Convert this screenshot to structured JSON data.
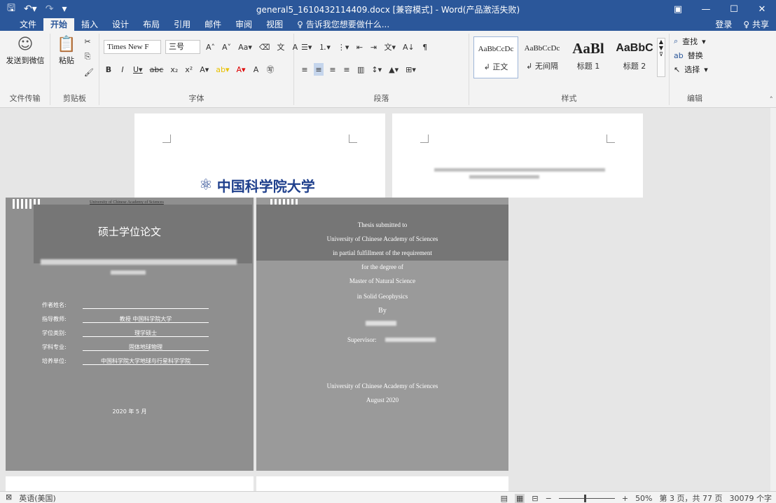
{
  "titlebar": {
    "doc_title": "general5_1610432114409.docx [兼容模式] - Word(产品激活失败)",
    "qa_icons": [
      "save-icon",
      "undo-icon",
      "redo-icon",
      "customize-icon"
    ],
    "tabs": [
      "文件",
      "开始",
      "插入",
      "设计",
      "布局",
      "引用",
      "邮件",
      "审阅",
      "视图"
    ],
    "active_tab": "开始",
    "search": "♀ 告诉我您想要做什么...",
    "signin": "登录",
    "share": "♀ 共享"
  },
  "ribbon": {
    "send_wechat": "发送到微信",
    "paste": "粘贴",
    "font_name": "Times New F",
    "font_size": "三号",
    "styles": [
      {
        "sample": "AaBbCcDc",
        "name": "正文"
      },
      {
        "sample": "AaBbCcDc",
        "name": "无间隔"
      },
      {
        "sample": "AaBl",
        "name": "标题 1"
      },
      {
        "sample": "AaBbC",
        "name": "标题 2"
      }
    ],
    "find": "查找",
    "replace": "替换",
    "select": "选择",
    "groups": [
      "文件传输",
      "剪贴板",
      "字体",
      "段落",
      "样式",
      "编辑"
    ]
  },
  "document": {
    "logo_text": "中国科学院大学",
    "logo_sub": "University of Chinese Academy of Sciences",
    "cn_title": "硕士学位论文",
    "info_labels": [
      "作者姓名:",
      "指导教师:",
      "学位类别:",
      "学科专业:",
      "培养单位:"
    ],
    "info_values": [
      "",
      "教授  中国科学院大学",
      "理学硕士",
      "固体地球物理",
      "中国科学院大学地球与行星科学学院"
    ],
    "cn_date": "2020 年 5 月",
    "en_lines": [
      "Thesis submitted to",
      "University of Chinese Academy of Sciences",
      "in partial fulfillment of the requirement",
      "for the degree of",
      "Master of Natural Science",
      "in Solid Geophysics",
      "By"
    ],
    "supervisor": "Supervisor:",
    "en_university": "University of Chinese Academy of Sciences",
    "en_date": "August 2020"
  },
  "statusbar": {
    "language": "英语(美国)",
    "zoom": "50%",
    "page_info": "第 3 页，共 77 页",
    "word_count": "30079 个字"
  }
}
